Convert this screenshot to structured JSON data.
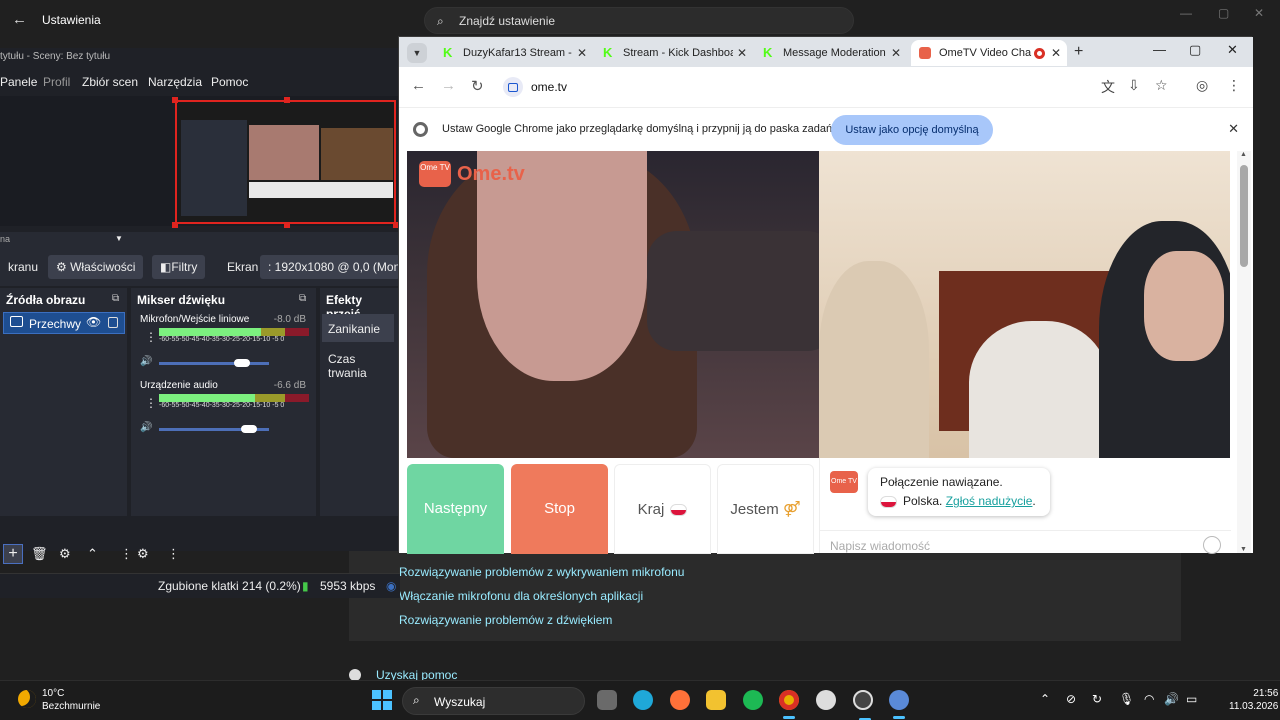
{
  "settings": {
    "title": "Ustawienia",
    "search_placeholder": "Znajdź ustawienie",
    "help_links": [
      "Rozwiązywanie problemów z wykrywaniem mikrofonu",
      "Włączanie mikrofonu dla określonych aplikacji",
      "Rozwiązywanie problemów z dźwiękiem"
    ],
    "get_help": "Uzyskaj pomoc"
  },
  "obs": {
    "title": "tytułu - Sceny: Bez tytułu",
    "menu": [
      "Panele",
      "Profil",
      "Zbiór scen",
      "Narzędzia",
      "Pomoc"
    ],
    "scene_label": "na",
    "toolbar": {
      "scene": "kranu",
      "properties": "Właściwości",
      "filters": "Filtry",
      "screen": "Ekran",
      "resolution": ": 1920x1080 @ 0,0 (Monito"
    },
    "sources_header": "Źródła obrazu",
    "source_item": "Przechwy",
    "mixer_header": "Mikser dźwięku",
    "mixer": [
      {
        "name": "Mikrofon/Wejście liniowe",
        "db": "-8.0 dB",
        "level": 0.68,
        "volume": 0.75
      },
      {
        "name": "Urządzenie audio",
        "db": "-6.6 dB",
        "level": 0.64,
        "volume": 0.82
      }
    ],
    "meter_scale": "-60-55-50-45-40-35-30-25-20-15-10 -5 0",
    "effects_header": "Efekty przejś",
    "effects": [
      "Zanikanie",
      "Czas trwania"
    ],
    "status": {
      "dropped": "Zgubione klatki 214 (0.2%)",
      "bitrate": "5953 kbps"
    }
  },
  "chrome": {
    "tabs": [
      {
        "title": "DuzyKafar13 Stream - ",
        "favicon": "kick-icon"
      },
      {
        "title": "Stream - Kick Dashboa",
        "favicon": "kick-icon"
      },
      {
        "title": "Message Moderation",
        "favicon": "kick-icon"
      },
      {
        "title": "OmeTV Video Cha",
        "favicon": "ometv-icon",
        "active": true
      }
    ],
    "url": "ome.tv",
    "infobar_message": "Ustaw Google Chrome jako przeglądarkę domyślną i przypnij ją do paska zadań",
    "infobar_button": "Ustaw jako opcję domyślną"
  },
  "ometv": {
    "logo_badge": "Ome TV",
    "logo_text": "Ome.tv",
    "buttons": {
      "next": "Następny",
      "stop": "Stop",
      "country": "Kraj",
      "gender": "Jestem"
    },
    "chat": {
      "line1": "Połączenie nawiązane.",
      "country": "Polska.",
      "report": "Zgłoś nadużycie",
      "report_suffix": ".",
      "placeholder": "Napisz wiadomość"
    }
  },
  "taskbar": {
    "temperature": "10°C",
    "weather": "Bezchmurnie",
    "search": "Wyszukaj",
    "time": "21:56",
    "date": "11.03.2026"
  },
  "colors": {
    "obs_selection": "#1e4e91",
    "obs_frame": "#e0241f",
    "ometv_next": "#6fd6a2",
    "ometv_stop": "#ef7a5c",
    "link": "#99ebff"
  }
}
